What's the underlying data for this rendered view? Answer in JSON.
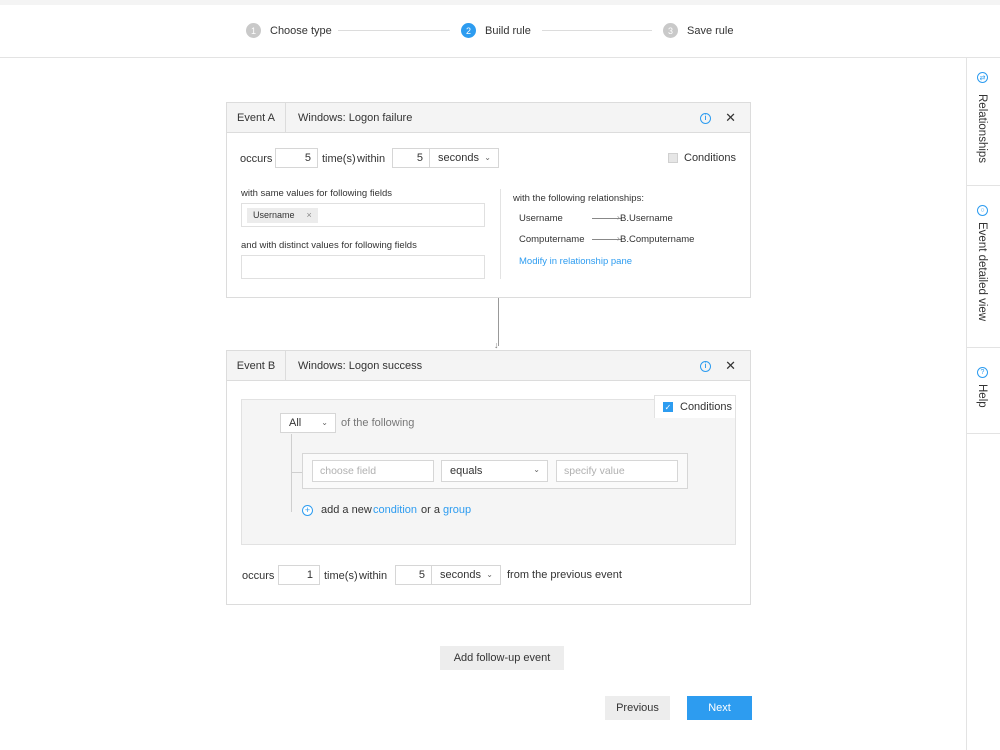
{
  "stepper": {
    "steps": [
      {
        "number": "1",
        "label": "Choose type"
      },
      {
        "number": "2",
        "label": "Build rule"
      },
      {
        "number": "3",
        "label": "Save rule"
      }
    ],
    "active_step": "2"
  },
  "side_panel": {
    "tabs": [
      {
        "label": "Relationships",
        "icon": "relationships-icon"
      },
      {
        "label": "Event detailed view",
        "icon": "event-detail-icon"
      },
      {
        "label": "Help",
        "icon": "help-icon"
      }
    ]
  },
  "event_a": {
    "label": "Event A",
    "type": "Windows: Logon failure",
    "occurs_label": "occurs",
    "count": "5",
    "times_label": "time(s)",
    "within_label": "within",
    "within_value": "5",
    "unit": "seconds",
    "conditions_label": "Conditions",
    "same_values_label": "with same values for following fields",
    "same_values_chip": "Username",
    "chip_remove": "×",
    "distinct_values_label": "and with distinct values for following fields",
    "relationships_title": "with the following relationships:",
    "relationships": [
      {
        "from": "Username",
        "to": "B.Username"
      },
      {
        "from": "Computername",
        "to": "B.Computername"
      }
    ],
    "modify_link": "Modify in relationship pane"
  },
  "event_b": {
    "label": "Event B",
    "type": "Windows: Logon success",
    "conditions_label": "Conditions",
    "conditions_checked": true,
    "match_select": "All",
    "of_following_label": "of the following",
    "field_placeholder": "choose field",
    "operator": "equals",
    "value_placeholder": "specify value",
    "add_new_label": "add a new",
    "condition_link": "condition",
    "or_a_label": "or a",
    "group_link": "group",
    "occurs_label": "occurs",
    "count": "1",
    "times_label": "time(s)",
    "within_label": "within",
    "within_value": "5",
    "unit": "seconds",
    "from_previous_label": "from the previous event"
  },
  "buttons": {
    "add_follow_up": "Add follow-up event",
    "previous": "Previous",
    "next": "Next"
  },
  "colors": {
    "accent": "#2d9cf0",
    "header_bg": "#f4f4f4",
    "border": "#dcdcdc"
  }
}
